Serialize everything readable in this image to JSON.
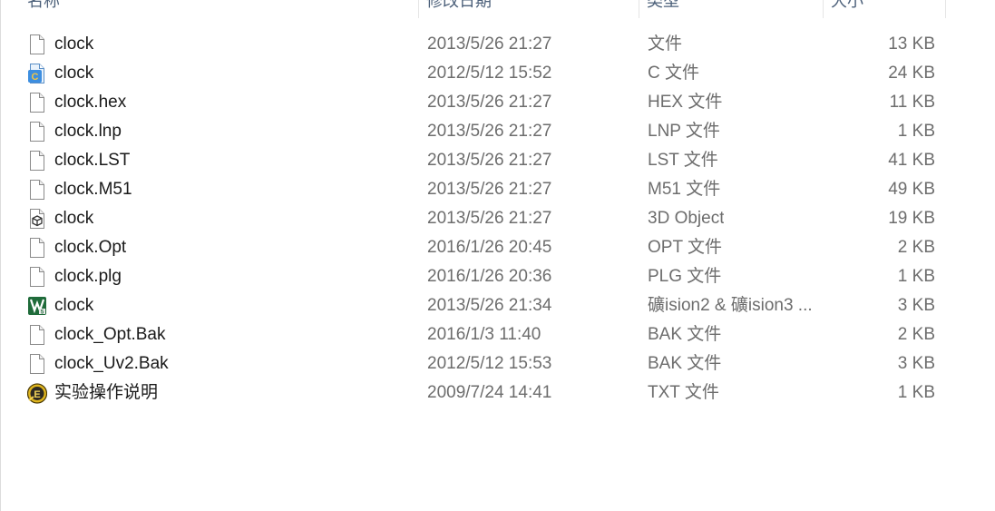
{
  "columns": {
    "name": "名称",
    "date": "修改日期",
    "type": "类型",
    "size": "大小"
  },
  "files": [
    {
      "name": "clock",
      "date": "2013/5/26 21:27",
      "type": "文件",
      "size": "13 KB",
      "icon": "generic-file-icon"
    },
    {
      "name": "clock",
      "date": "2012/5/12 15:52",
      "type": "C 文件",
      "size": "24 KB",
      "icon": "c-source-file-icon"
    },
    {
      "name": "clock.hex",
      "date": "2013/5/26 21:27",
      "type": "HEX 文件",
      "size": "11 KB",
      "icon": "generic-file-icon"
    },
    {
      "name": "clock.lnp",
      "date": "2013/5/26 21:27",
      "type": "LNP 文件",
      "size": "1 KB",
      "icon": "generic-file-icon"
    },
    {
      "name": "clock.LST",
      "date": "2013/5/26 21:27",
      "type": "LST 文件",
      "size": "41 KB",
      "icon": "generic-file-icon"
    },
    {
      "name": "clock.M51",
      "date": "2013/5/26 21:27",
      "type": "M51 文件",
      "size": "49 KB",
      "icon": "generic-file-icon"
    },
    {
      "name": "clock",
      "date": "2013/5/26 21:27",
      "type": "3D Object",
      "size": "19 KB",
      "icon": "3d-object-file-icon"
    },
    {
      "name": "clock.Opt",
      "date": "2016/1/26 20:45",
      "type": "OPT 文件",
      "size": "2 KB",
      "icon": "generic-file-icon"
    },
    {
      "name": "clock.plg",
      "date": "2016/1/26 20:36",
      "type": "PLG 文件",
      "size": "1 KB",
      "icon": "generic-file-icon"
    },
    {
      "name": "clock",
      "date": "2013/5/26 21:34",
      "type": "礦ision2 & 礦ision3 ...",
      "size": "3 KB",
      "icon": "keil-uvision-project-icon"
    },
    {
      "name": "clock_Opt.Bak",
      "date": "2016/1/3 11:40",
      "type": "BAK 文件",
      "size": "2 KB",
      "icon": "generic-file-icon"
    },
    {
      "name": "clock_Uv2.Bak",
      "date": "2012/5/12 15:53",
      "type": "BAK 文件",
      "size": "3 KB",
      "icon": "generic-file-icon"
    },
    {
      "name": "实验操作说明",
      "date": "2009/7/24 14:41",
      "type": "TXT 文件",
      "size": "1 KB",
      "icon": "text-editor-file-icon"
    }
  ]
}
